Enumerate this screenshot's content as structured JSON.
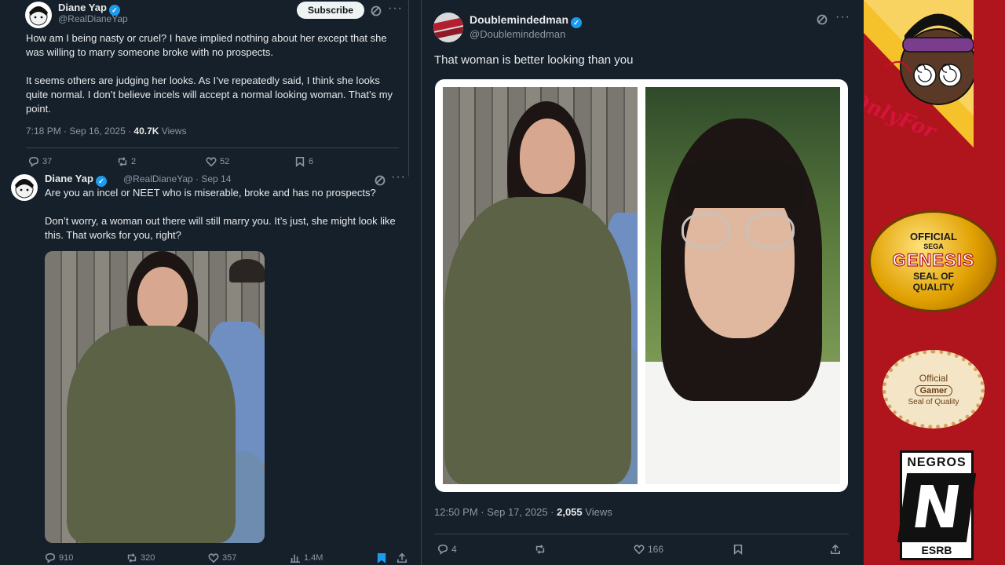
{
  "left_panel": {
    "tweet1": {
      "name": "Diane Yap",
      "handle": "@RealDianeYap",
      "subscribe_label": "Subscribe",
      "para1": "How am I being nasty or cruel? I have implied nothing about her except that she was willing to marry someone broke with no prospects.",
      "para2": "It seems others are judging her looks. As I’ve repeatedly said, I think she looks quite normal. I don’t believe incels will accept a normal looking woman. That’s my point.",
      "time": "7:18 PM · Sep 16, 2025 · ",
      "views_count": "40.7K",
      "views_label": " Views",
      "replies": "37",
      "reposts": "2",
      "likes": "52",
      "bookmarks": "6"
    },
    "tweet2": {
      "name": "Diane Yap",
      "handle_date": "@RealDianeYap · Sep 14",
      "para1": "Are you an incel or NEET who is miserable, broke and has no prospects?",
      "para2": "Don’t worry, a woman out there will still marry you. It’s just, she might look like this. That works for you, right?",
      "replies": "910",
      "reposts": "320",
      "likes": "357",
      "views": "1.4M"
    }
  },
  "middle_panel": {
    "name": "Doublemindedman",
    "handle": "@Doublemindedman",
    "text": "That woman is better looking than you",
    "time": "12:50 PM · Sep 17, 2025 · ",
    "views_count": "2,055",
    "views_label": " Views",
    "replies": "4",
    "likes": "166"
  },
  "right_panel": {
    "badge_text": "OnlyFor",
    "genesis_seal": {
      "line1": "OFFICIAL",
      "line2": "SEGA",
      "line3": "GENESIS",
      "line4": "SEAL OF",
      "line5": "QUALITY"
    },
    "gamer_seal": {
      "line1": "Official",
      "line2": "Gamer",
      "line3": "Seal of Quality"
    },
    "rating": {
      "top": "NEGROS",
      "letter": "N",
      "bottom": "ESRB"
    }
  },
  "colors": {
    "background": "#15202b",
    "verified": "#1d9bf0",
    "muted_text": "#8b98a5",
    "right_panel_red": "#b0141c",
    "bookmark_active": "#1d9bf0"
  },
  "icons": [
    "verified-icon",
    "grok-icon",
    "more-icon",
    "reply-icon",
    "repost-icon",
    "like-icon",
    "bookmark-icon",
    "views-icon",
    "share-icon"
  ]
}
